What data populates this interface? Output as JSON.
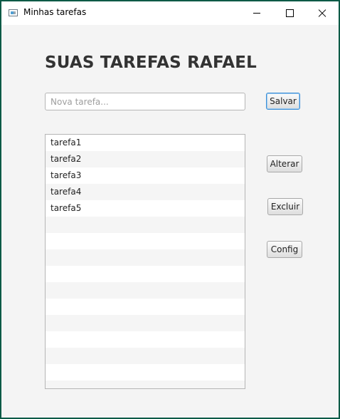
{
  "window": {
    "title": "Minhas tarefas",
    "icons": {
      "app": "app-window-icon",
      "minimize": "minimize-icon",
      "maximize": "maximize-icon",
      "close": "close-icon"
    }
  },
  "header": {
    "title": "SUAS TAREFAS RAFAEL"
  },
  "form": {
    "input_value": "",
    "input_placeholder": "Nova tarefa...",
    "save_label": "Salvar"
  },
  "actions": {
    "alter_label": "Alterar",
    "delete_label": "Excluir",
    "config_label": "Config"
  },
  "tasks": [
    "tarefa1",
    "tarefa2",
    "tarefa3",
    "tarefa4",
    "tarefa5"
  ],
  "colors": {
    "border": "#0b5a46",
    "background": "#f4f4f4",
    "focus": "#3c8fd6"
  }
}
